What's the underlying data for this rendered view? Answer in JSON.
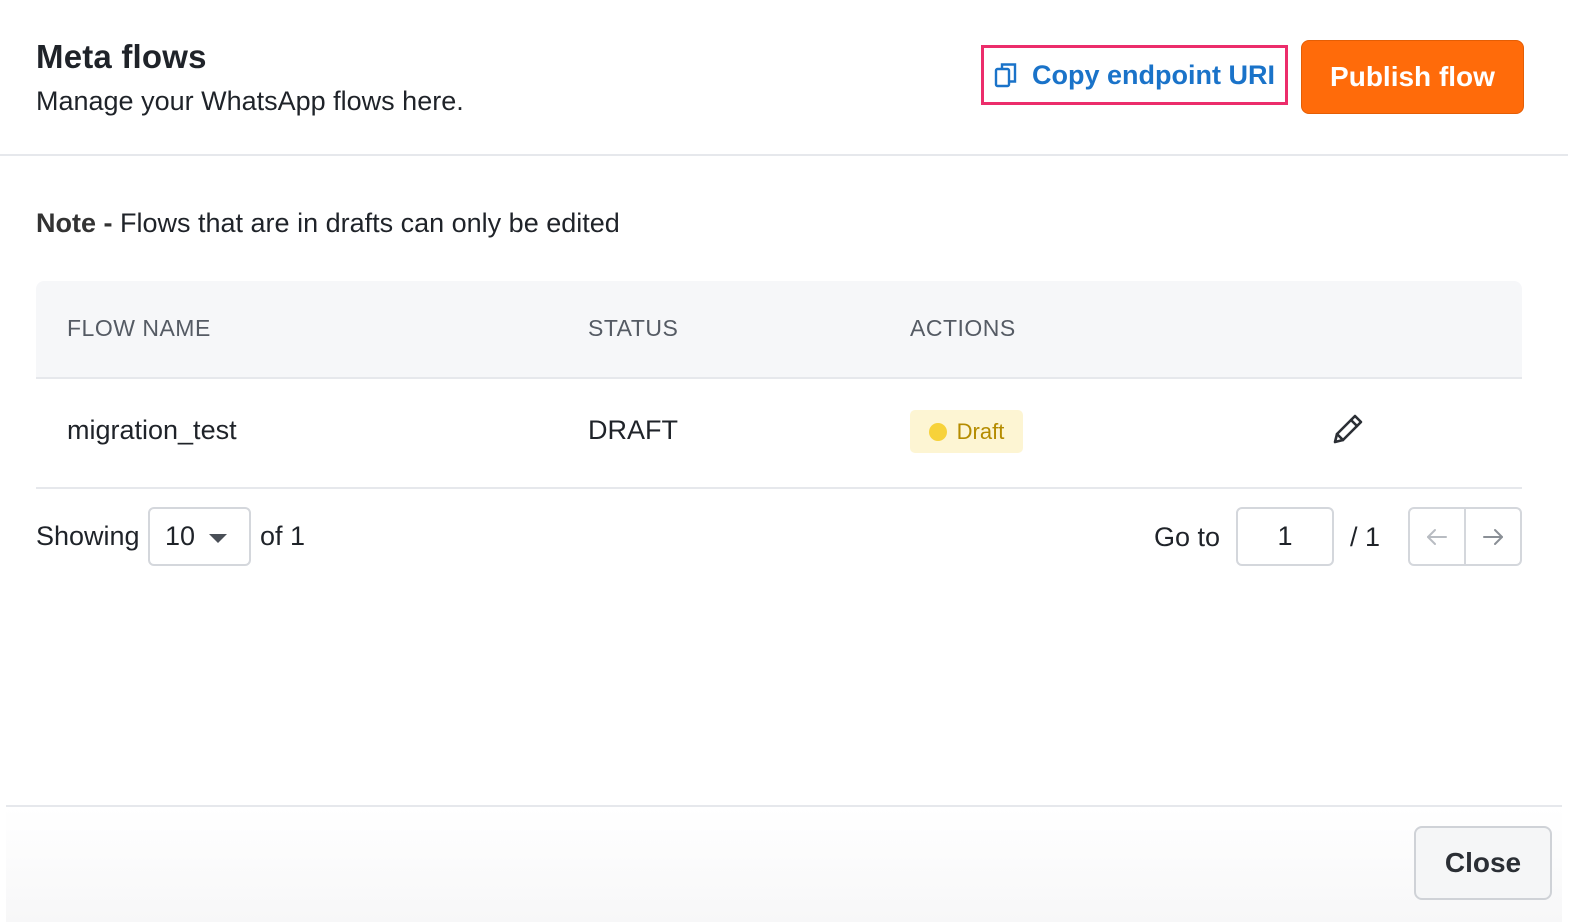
{
  "header": {
    "title": "Meta flows",
    "subtitle": "Manage your WhatsApp flows here.",
    "copy_button_label": "Copy endpoint URI",
    "publish_button_label": "Publish flow"
  },
  "note": {
    "label": "Note -",
    "text": " Flows that are in drafts can only be edited"
  },
  "table": {
    "columns": [
      "FLOW NAME",
      "STATUS",
      "ACTIONS"
    ],
    "rows": [
      {
        "flow_name": "migration_test",
        "status": "DRAFT",
        "badge": "Draft"
      }
    ]
  },
  "pagination": {
    "showing_label": "Showing",
    "page_size": "10",
    "of_label": "of 1",
    "goto_label": "Go to",
    "current_page": "1",
    "total_pages_label": "/ 1"
  },
  "footer": {
    "close_label": "Close"
  },
  "colors": {
    "accent_orange": "#ff6b0a",
    "link_blue": "#1a73c9",
    "highlight_pink": "#ec2d6b",
    "draft_badge_bg": "#fdf5d3",
    "draft_dot": "#f7d23a"
  },
  "icons": {
    "copy": "copy-icon",
    "edit": "pencil-icon",
    "prev": "arrow-left-icon",
    "next": "arrow-right-icon",
    "caret": "chevron-down-icon"
  }
}
